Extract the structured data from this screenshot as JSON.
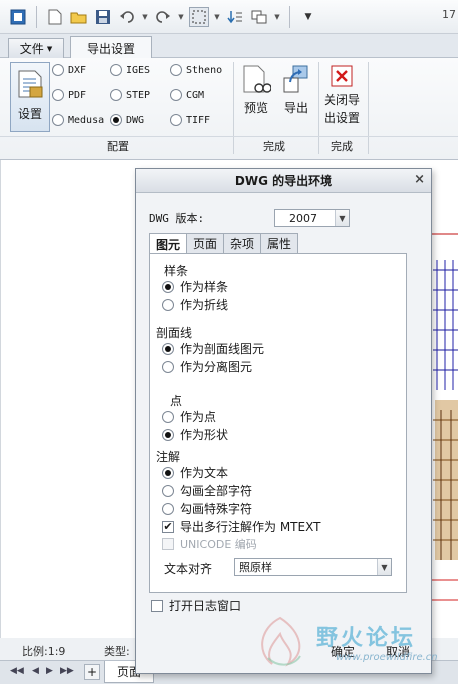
{
  "quick_access": {
    "icons": [
      "window-icon",
      "new-icon",
      "open-icon",
      "save-icon",
      "undo-icon",
      "redo-icon",
      "select-box-icon",
      "regenerate-icon",
      "windows-icon",
      "customize-icon"
    ],
    "right_text": "17"
  },
  "tabs": {
    "file": "文件",
    "export": "导出设置"
  },
  "ribbon": {
    "settings_label": "设置",
    "formats": [
      {
        "label": "DXF",
        "selected": false
      },
      {
        "label": "IGES",
        "selected": false
      },
      {
        "label": "Stheno",
        "selected": false
      },
      {
        "label": "PDF",
        "selected": false
      },
      {
        "label": "STEP",
        "selected": false
      },
      {
        "label": "CGM",
        "selected": false
      },
      {
        "label": "Medusa",
        "selected": false
      },
      {
        "label": "DWG",
        "selected": true
      },
      {
        "label": "TIFF",
        "selected": false
      }
    ],
    "preview_label": "预览",
    "export_label": "导出",
    "close_label_line1": "关闭导",
    "close_label_line2": "出设置",
    "group_config": "配置",
    "group_finish1": "完成",
    "group_finish2": "完成"
  },
  "status": {
    "scale": "比例:1:9",
    "type": "类型:"
  },
  "pagebar": {
    "page_tab": "页面",
    "add": "+"
  },
  "dialog": {
    "title": "DWG 的导出环境",
    "close": "×",
    "version_label": "DWG 版本:",
    "version_value": "2007",
    "tabs": [
      "图元",
      "页面",
      "杂项",
      "属性"
    ],
    "spline_title": "样条",
    "spline_opt1": "作为样条",
    "spline_opt2": "作为折线",
    "hatch_title": "剖面线",
    "hatch_opt1": "作为剖面线图元",
    "hatch_opt2": "作为分离图元",
    "point_title": "点",
    "point_opt1": "作为点",
    "point_opt2": "作为形状",
    "note_title": "注解",
    "note_opt1": "作为文本",
    "note_opt2": "勾画全部字符",
    "note_opt3": "勾画特殊字符",
    "mtext_label": "导出多行注解作为 MTEXT",
    "unicode_label": "UNICODE 编码",
    "align_label": "文本对齐",
    "align_value": "照原样",
    "log_label": "打开日志窗口",
    "ok": "确定",
    "cancel": "取消"
  },
  "watermark": {
    "text": "野火论坛",
    "url": "www.proewildfire.cn"
  }
}
